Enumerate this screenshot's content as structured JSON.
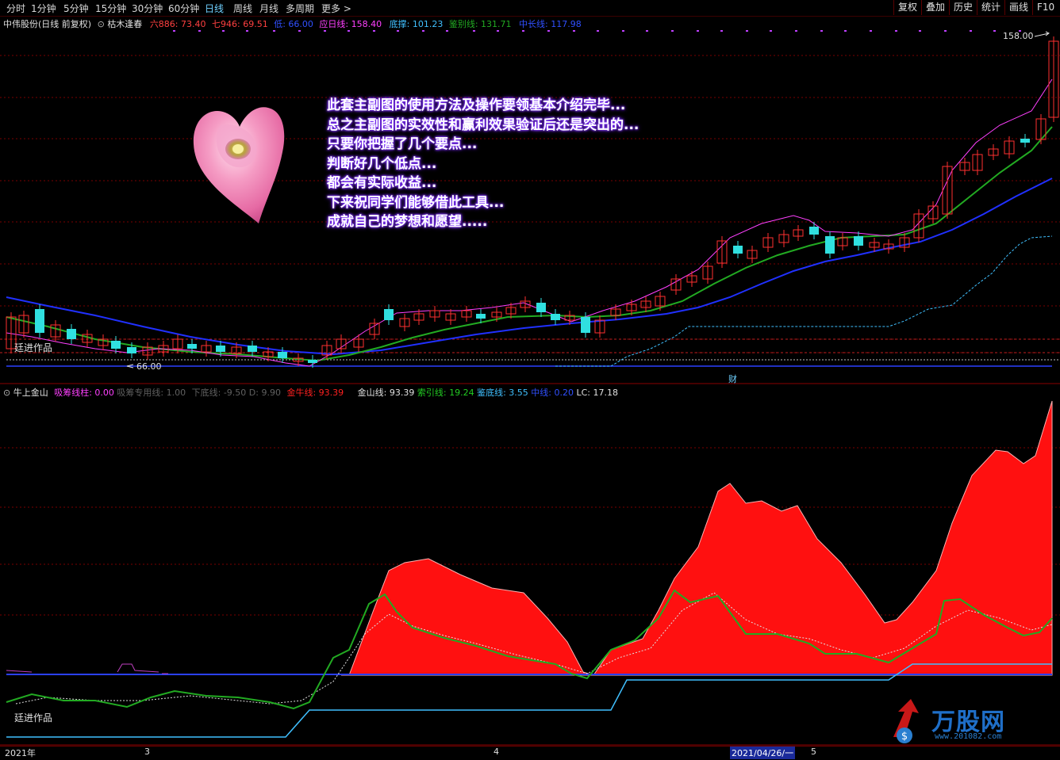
{
  "toolbar": {
    "periods": [
      "分时",
      "1分钟",
      "5分钟",
      "15分钟",
      "30分钟",
      "60分钟",
      "日线",
      "周线",
      "月线",
      "多周期",
      "更多 >"
    ],
    "active_period": "日线",
    "right_buttons": [
      "复权",
      "叠加",
      "历史",
      "统计",
      "画线",
      "F10"
    ]
  },
  "main_legend": {
    "stock": "中伟股份(日线 前复权)",
    "indicator": "枯木逢春",
    "items": [
      {
        "text": "六886: 73.40",
        "color": "#ff4040"
      },
      {
        "text": "七946: 69.51",
        "color": "#ff4040"
      },
      {
        "text": "低: 66.00",
        "color": "#3050ff"
      },
      {
        "text": "应日线: 158.40",
        "color": "#ff40ff"
      },
      {
        "text": "底撑: 101.23",
        "color": "#40c0ff"
      },
      {
        "text": "鉴别线: 131.71",
        "color": "#22aa22"
      },
      {
        "text": "中长线: 117.98",
        "color": "#3050ff"
      }
    ]
  },
  "message": [
    "此套主副图的使用方法及操作要领基本介绍完毕...",
    "总之主副图的实效性和赢利效果验证后还是突出的...",
    "只要你把握了几个要点...",
    "判断好几个低点...",
    "都会有实际收益...",
    "下来祝同学们能够借此工具...",
    "成就自己的梦想和愿望....."
  ],
  "main_chart": {
    "label_high": "158.00",
    "label_low": "66.00",
    "watermark": "廷进作品",
    "fin_marker": "财"
  },
  "sub_legend": {
    "indicator": "牛上金山",
    "items": [
      {
        "text": "吸筹线柱: 0.00",
        "color": "#ff40ff"
      },
      {
        "text": "吸筹专用线: 1.00",
        "color": "#606060"
      },
      {
        "text": "下底线: -9.50",
        "color": "#606060"
      },
      {
        "text": "D: 9.90",
        "color": "#606060"
      },
      {
        "text": "金牛线: 93.39",
        "color": "#ff2020"
      },
      {
        "text": "金山线: 93.39",
        "color": "#e0e0e0"
      },
      {
        "text": "索引线: 19.24",
        "color": "#22cc22"
      },
      {
        "text": "鉴底线: 3.55",
        "color": "#40c0ff"
      },
      {
        "text": "中线: 0.20",
        "color": "#3050ff"
      },
      {
        "text": "LC: 17.18",
        "color": "#e0e0e0"
      }
    ],
    "watermark": "廷进作品"
  },
  "timebar": {
    "labels": [
      "2021年",
      "3",
      "4",
      "2021/04/26/一",
      "5"
    ]
  },
  "logo": {
    "text": "万股网",
    "url_text": "www.201082.com"
  },
  "colors": {
    "up": "#ff3030",
    "down": "#30e0e0",
    "grid": "#7a0000",
    "accent": "#6fd0ff"
  }
}
